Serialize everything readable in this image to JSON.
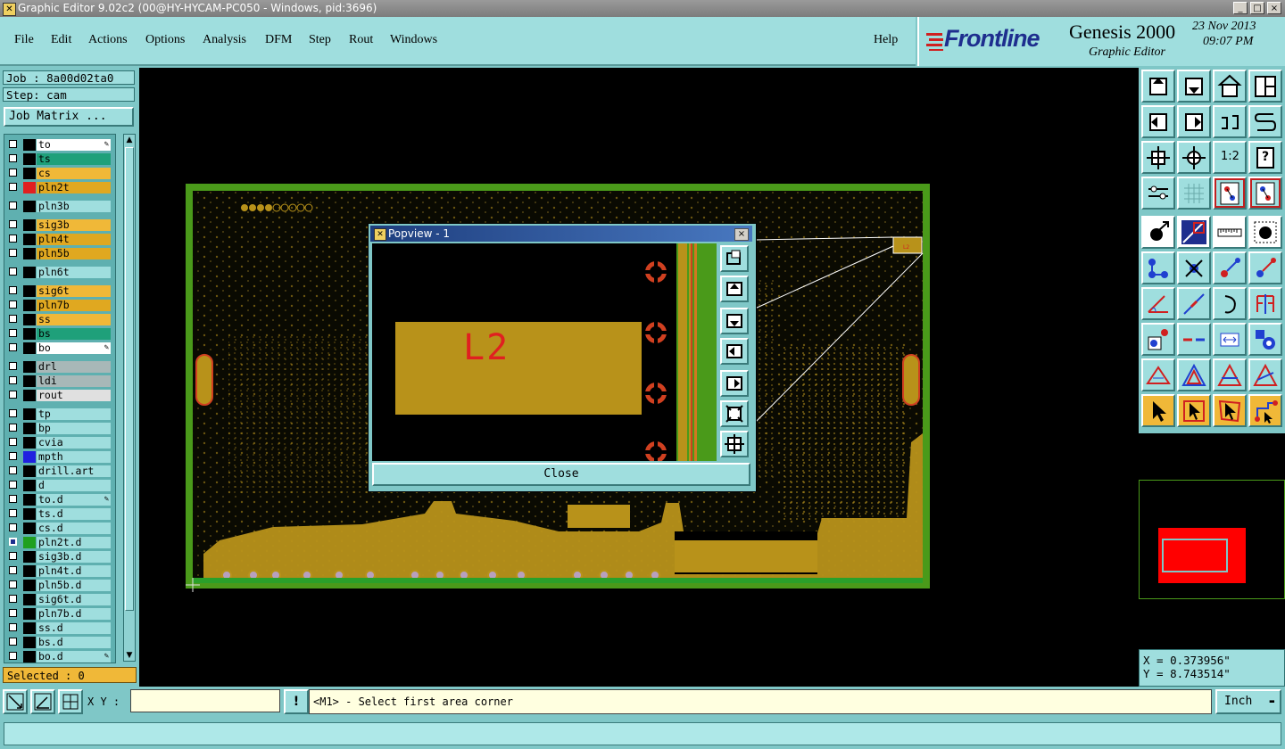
{
  "window": {
    "title": "Graphic Editor 9.02c2 (00@HY-HYCAM-PC050 - Windows, pid:3696)",
    "minimize_glyph": "_",
    "maximize_glyph": "□",
    "close_glyph": "×"
  },
  "menu": {
    "items": [
      "File",
      "Edit",
      "Actions",
      "Options",
      "Analysis",
      "DFM",
      "Step",
      "Rout",
      "Windows"
    ],
    "help": "Help"
  },
  "brand": {
    "logo": "Frontline",
    "product": "Genesis 2000",
    "subtitle": "Graphic Editor",
    "date": "23 Nov 2013",
    "time": "09:07 PM"
  },
  "job": {
    "job_label": "Job : 8a00d02ta0",
    "step_label": "Step: cam",
    "matrix_button": "Job Matrix ..."
  },
  "layers": [
    {
      "name": "to",
      "color": "#ffffff",
      "swatch": "#000000",
      "edit": true
    },
    {
      "name": "ts",
      "color": "#1fa07a",
      "swatch": "#000000"
    },
    {
      "name": "cs",
      "color": "#f0b838",
      "swatch": "#000000"
    },
    {
      "name": "pln2t",
      "color": "#e0a820",
      "swatch": "#e02020"
    },
    {
      "name": "pln3b",
      "color": "#9fdede",
      "swatch": "#000000",
      "gap": true
    },
    {
      "name": "sig3b",
      "color": "#f0b838",
      "swatch": "#000000",
      "gap": true
    },
    {
      "name": "pln4t",
      "color": "#e0a820",
      "swatch": "#000000"
    },
    {
      "name": "pln5b",
      "color": "#e0a820",
      "swatch": "#000000"
    },
    {
      "name": "pln6t",
      "color": "#9fdede",
      "swatch": "#000000",
      "gap": true
    },
    {
      "name": "sig6t",
      "color": "#f0b838",
      "swatch": "#000000",
      "gap": true
    },
    {
      "name": "pln7b",
      "color": "#e0a820",
      "swatch": "#000000"
    },
    {
      "name": "ss",
      "color": "#f0b838",
      "swatch": "#000000"
    },
    {
      "name": "bs",
      "color": "#1fa07a",
      "swatch": "#000000"
    },
    {
      "name": "bo",
      "color": "#ffffff",
      "swatch": "#000000",
      "edit": true
    },
    {
      "name": "drl",
      "color": "#a8b8b8",
      "swatch": "#000000",
      "gap": true
    },
    {
      "name": "ldi",
      "color": "#a8b8b8",
      "swatch": "#000000"
    },
    {
      "name": "rout",
      "color": "#e0e0e0",
      "swatch": "#000000"
    },
    {
      "name": "tp",
      "color": "#9fdede",
      "swatch": "#000000",
      "gap": true
    },
    {
      "name": "bp",
      "color": "#9fdede",
      "swatch": "#000000"
    },
    {
      "name": "cvia",
      "color": "#9fdede",
      "swatch": "#000000"
    },
    {
      "name": "mpth",
      "color": "#9fdede",
      "swatch": "#2020e0"
    },
    {
      "name": "drill.art",
      "color": "#9fdede",
      "swatch": "#000000"
    },
    {
      "name": "d",
      "color": "#9fdede",
      "swatch": "#000000"
    },
    {
      "name": "to.d",
      "color": "#9fdede",
      "swatch": "#000000",
      "edit": true
    },
    {
      "name": "ts.d",
      "color": "#9fdede",
      "swatch": "#000000"
    },
    {
      "name": "cs.d",
      "color": "#9fdede",
      "swatch": "#000000"
    },
    {
      "name": "pln2t.d",
      "color": "#9fdede",
      "swatch": "#20a020",
      "checked": true
    },
    {
      "name": "sig3b.d",
      "color": "#9fdede",
      "swatch": "#000000"
    },
    {
      "name": "pln4t.d",
      "color": "#9fdede",
      "swatch": "#000000"
    },
    {
      "name": "pln5b.d",
      "color": "#9fdede",
      "swatch": "#000000"
    },
    {
      "name": "sig6t.d",
      "color": "#9fdede",
      "swatch": "#000000"
    },
    {
      "name": "pln7b.d",
      "color": "#9fdede",
      "swatch": "#000000"
    },
    {
      "name": "ss.d",
      "color": "#9fdede",
      "swatch": "#000000"
    },
    {
      "name": "bs.d",
      "color": "#9fdede",
      "swatch": "#000000"
    },
    {
      "name": "bo.d",
      "color": "#9fdede",
      "swatch": "#000000",
      "edit": true
    }
  ],
  "layer_edit_glyph": "✎",
  "scroll_up_glyph": "▲",
  "scroll_down_glyph": "▼",
  "selected_label": "Selected : 0",
  "popview": {
    "title": "Popview - 1",
    "close_x": "×",
    "zoom_label": "L2",
    "close_button": "Close"
  },
  "coords": {
    "x": "X = 0.373956\"",
    "y": "Y = 8.743514\""
  },
  "bottom": {
    "xy_label": "X Y :",
    "xy_value": "",
    "info_glyph": "!",
    "prompt": "<M1> - Select first area corner",
    "units": "Inch",
    "units_arrow": "▬"
  },
  "tool_labels": {
    "one_to_two": "1:2",
    "help_q": "?"
  },
  "colors": {
    "panel": "#7fc7c7",
    "panel_light": "#9fdede",
    "copper": "#b8921a",
    "board_green": "#4a9a1a",
    "highlight_red": "#ff0000"
  }
}
